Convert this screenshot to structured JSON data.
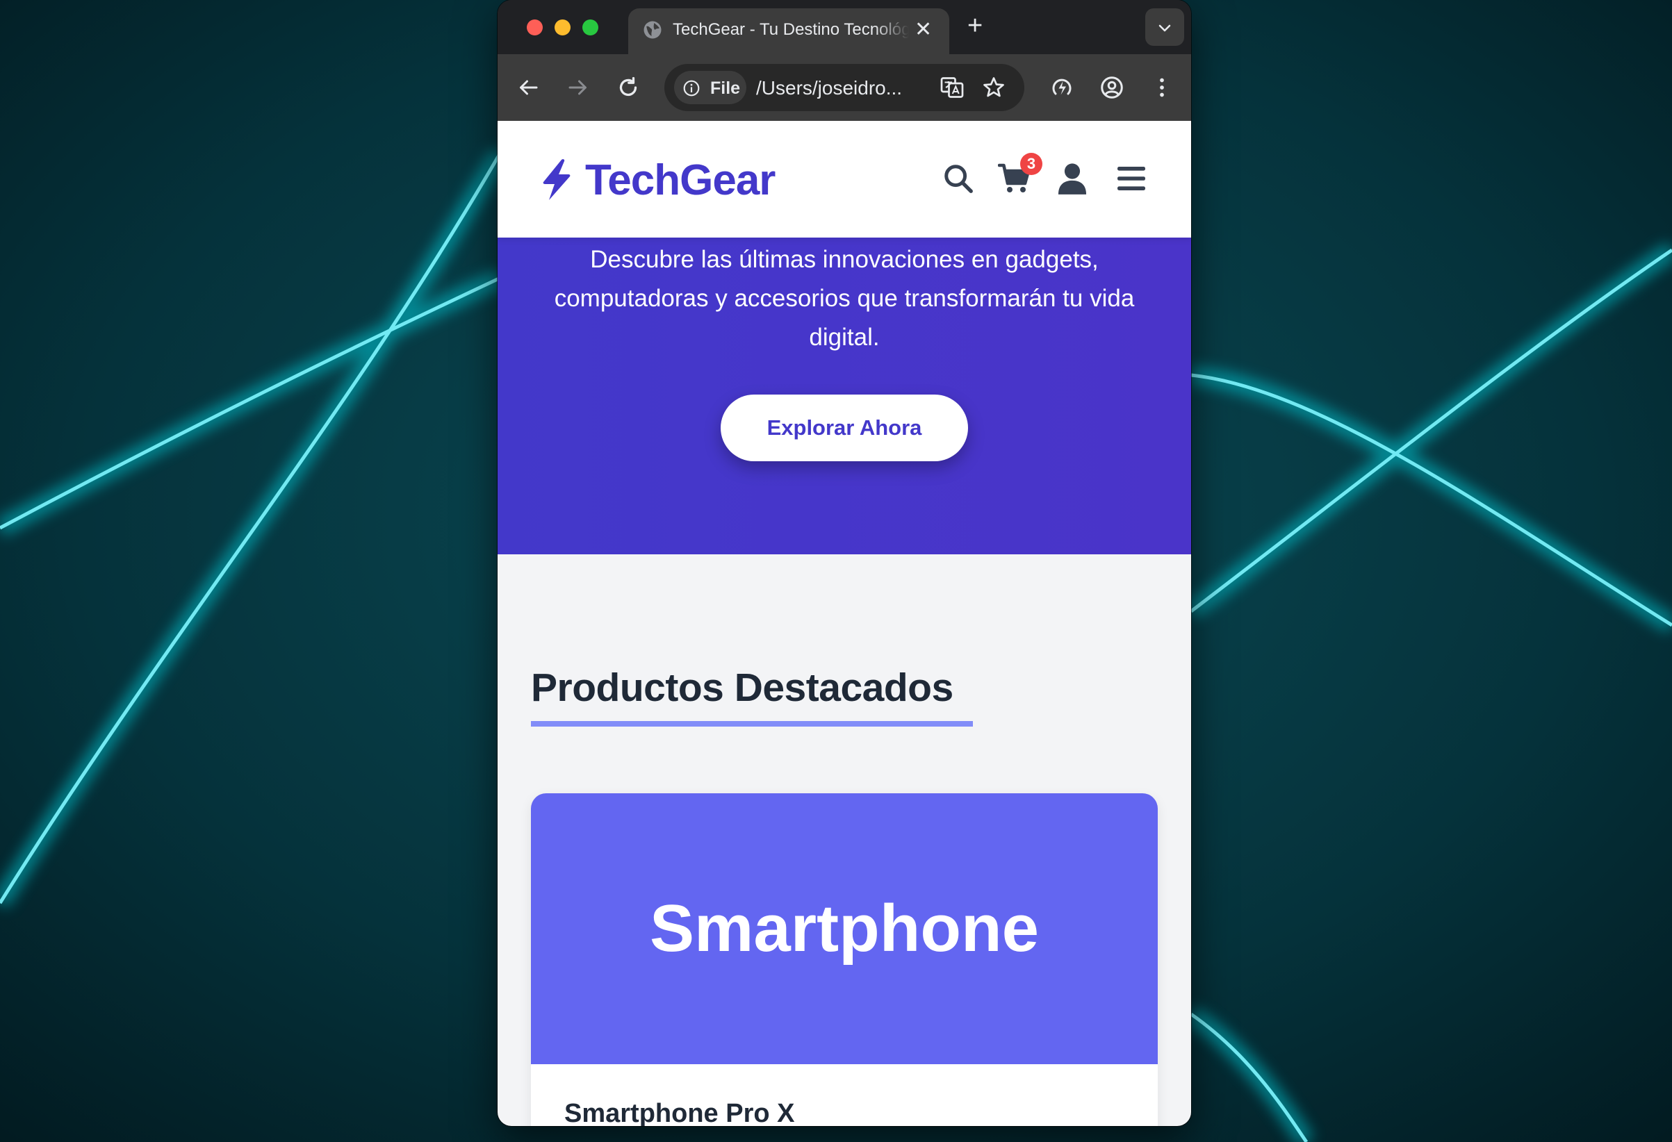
{
  "browser": {
    "tab_title": "TechGear - Tu Destino Tecnológico",
    "tab_close_glyph": "✕",
    "new_tab_glyph": "+",
    "site_info_label": "File",
    "url": "/Users/joseidro..."
  },
  "site": {
    "brand": "TechGear",
    "cart_count": "3",
    "hero_text": "Descubre las últimas innovaciones en gadgets, computadoras y accesorios que transformarán tu vida digital.",
    "hero_button": "Explorar Ahora",
    "section_title": "Productos Destacados",
    "products": [
      {
        "image_label": "Smartphone",
        "name": "Smartphone Pro X"
      }
    ]
  },
  "colors": {
    "brand": "#4338ca",
    "accent": "#6366f1",
    "badge": "#ef4444",
    "desktop_glow": "#00e5ee"
  },
  "icons": [
    "lightning-icon",
    "search-icon",
    "cart-icon",
    "user-icon",
    "menu-icon"
  ]
}
